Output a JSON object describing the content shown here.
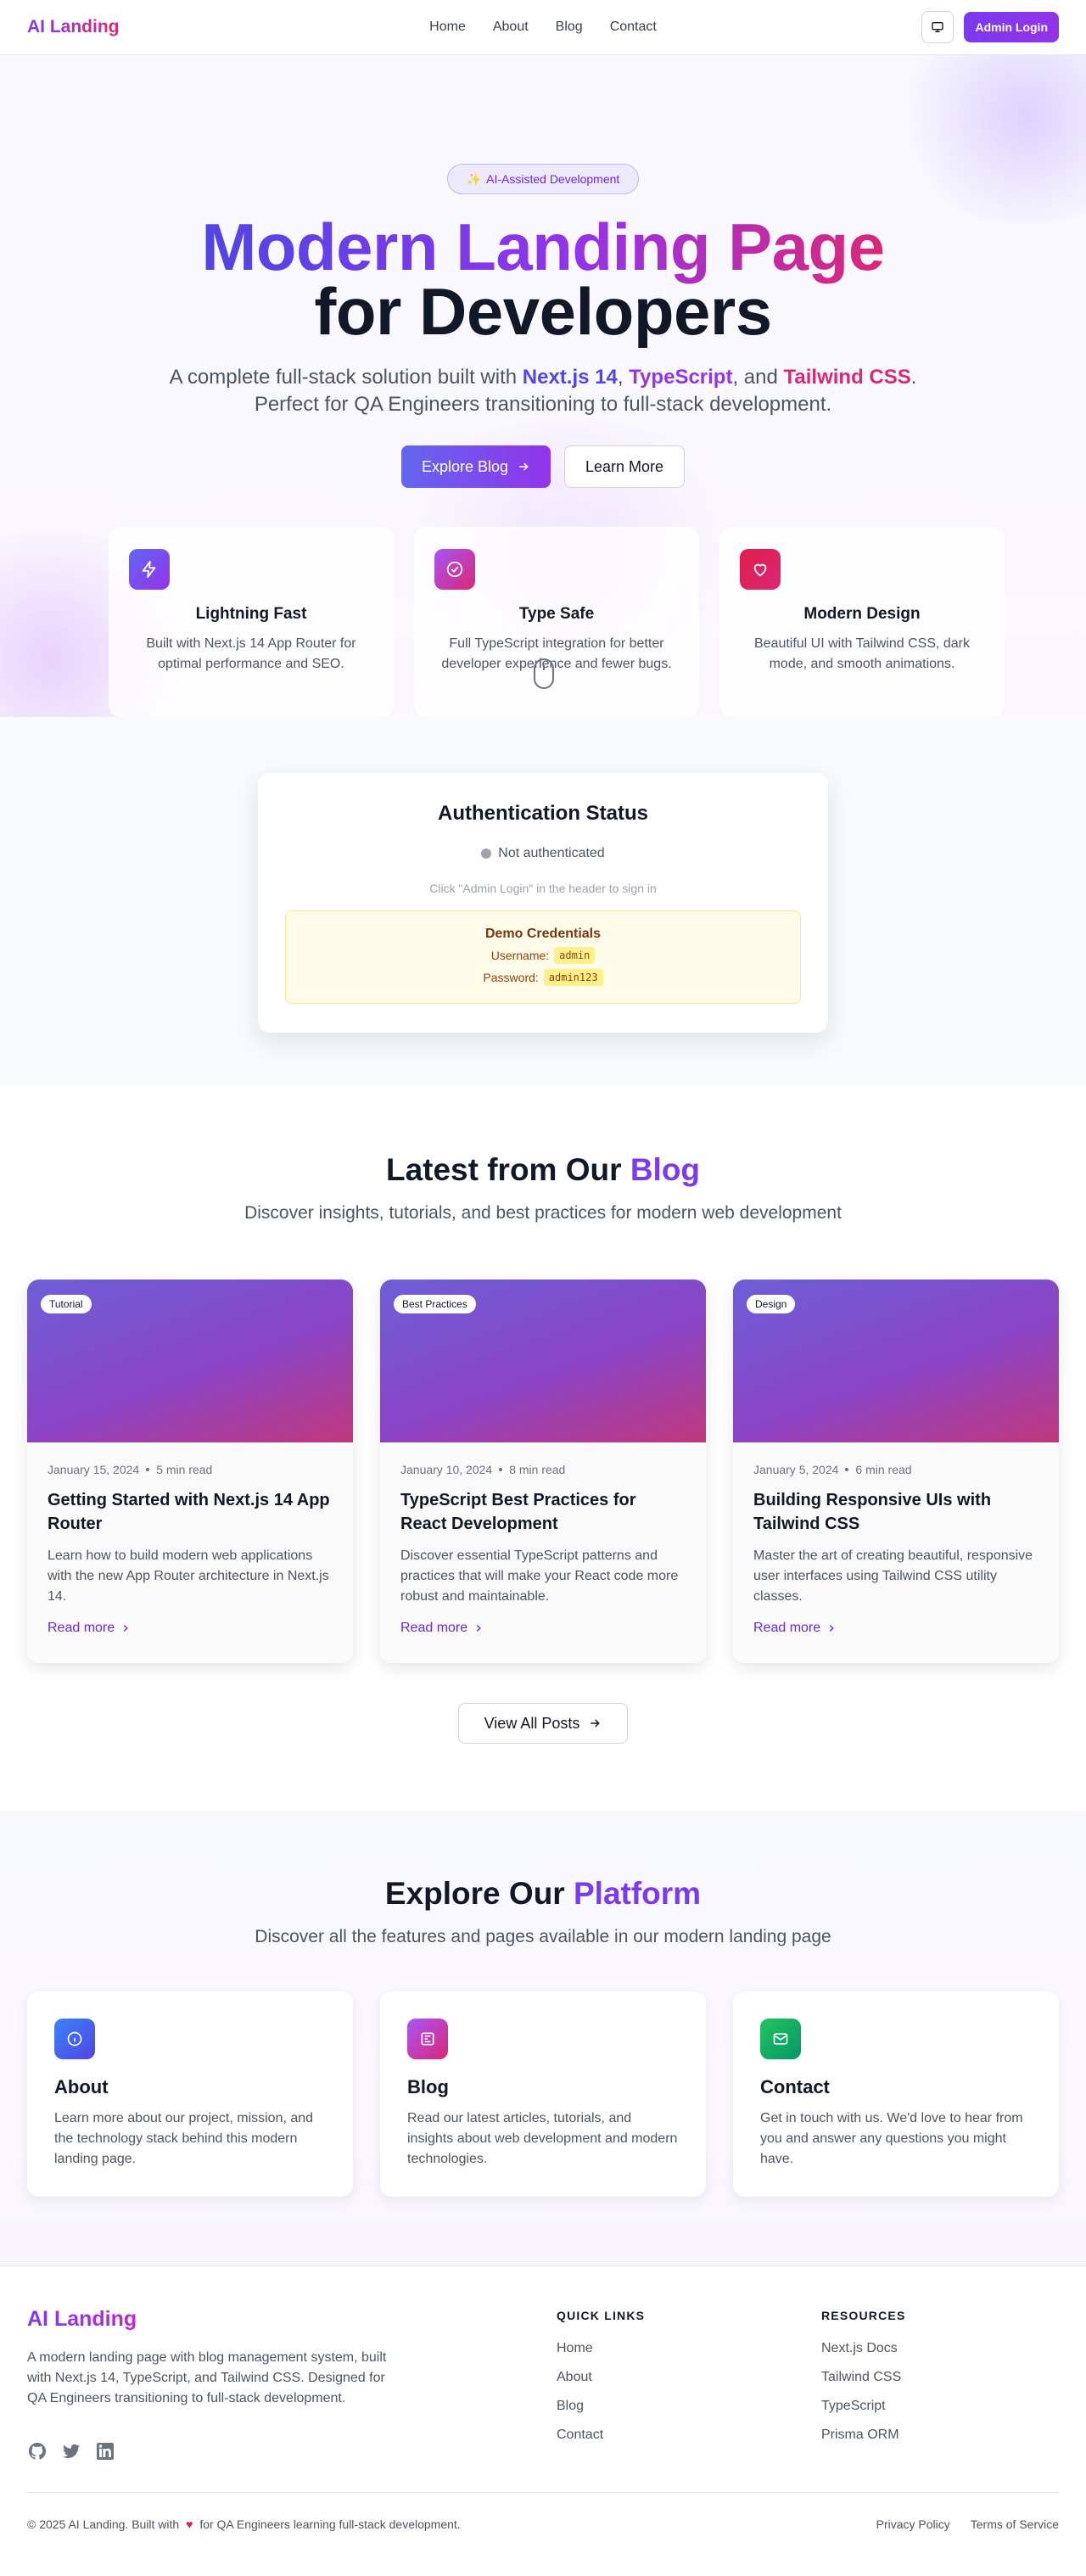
{
  "header": {
    "logo": "AI Landing",
    "nav": [
      "Home",
      "About",
      "Blog",
      "Contact"
    ],
    "admin_button": "Admin Login",
    "theme_icon": "monitor-icon"
  },
  "hero": {
    "badge": "AI-Assisted Development",
    "title_line1": "Modern Landing Page",
    "title_line2": "for Developers",
    "subtitle_prefix": "A complete full-stack solution built with",
    "hl1": "Next.js 14",
    "comma": ",",
    "hl2": "TypeScript",
    "and": ", and",
    "hl3": "Tailwind CSS",
    "subtitle_suffix": ". Perfect for QA Engineers transitioning to full-stack development.",
    "primary_button": "Explore Blog",
    "secondary_button": "Learn More",
    "features": [
      {
        "title": "Lightning Fast",
        "desc": "Built with Next.js 14 App Router for optimal performance and SEO.",
        "icon": "lightning-icon",
        "color": "#7c3aed"
      },
      {
        "title": "Type Safe",
        "desc": "Full TypeScript integration for better developer experience and fewer bugs.",
        "icon": "check-circle-icon",
        "color": "#c026d3"
      },
      {
        "title": "Modern Design",
        "desc": "Beautiful UI with Tailwind CSS, dark mode, and smooth animations.",
        "icon": "heart-icon",
        "color": "#e11d48"
      }
    ]
  },
  "auth": {
    "title": "Authentication Status",
    "status": "Not authenticated",
    "hint": "Click \"Admin Login\" in the header to sign in",
    "demo_title": "Demo Credentials",
    "username_label": "Username:",
    "username": "admin",
    "password_label": "Password:",
    "password": "admin123"
  },
  "blog": {
    "title_prefix": "Latest from Our",
    "title_accent": "Blog",
    "subtitle": "Discover insights, tutorials, and best practices for modern web development",
    "posts": [
      {
        "tag": "Tutorial",
        "date": "January 15, 2024",
        "read": "5 min read",
        "title": "Getting Started with Next.js 14 App Router",
        "desc": "Learn how to build modern web applications with the new App Router architecture in Next.js 14.",
        "link": "Read more"
      },
      {
        "tag": "Best Practices",
        "date": "January 10, 2024",
        "read": "8 min read",
        "title": "TypeScript Best Practices for React Development",
        "desc": "Discover essential TypeScript patterns and practices that will make your React code more robust and maintainable.",
        "link": "Read more"
      },
      {
        "tag": "Design",
        "date": "January 5, 2024",
        "read": "6 min read",
        "title": "Building Responsive UIs with Tailwind CSS",
        "desc": "Master the art of creating beautiful, responsive user interfaces using Tailwind CSS utility classes.",
        "link": "Read more"
      }
    ],
    "view_all": "View All Posts"
  },
  "platform": {
    "title_prefix": "Explore Our",
    "title_accent": "Platform",
    "subtitle": "Discover all the features and pages available in our modern landing page",
    "cards": [
      {
        "title": "About",
        "desc": "Learn more about our project, mission, and the technology stack behind this modern landing page.",
        "icon": "info-icon",
        "color": "#4f46e5"
      },
      {
        "title": "Blog",
        "desc": "Read our latest articles, tutorials, and insights about web development and modern technologies.",
        "icon": "newspaper-icon",
        "color": "#c026d3"
      },
      {
        "title": "Contact",
        "desc": "Get in touch with us. We'd love to hear from you and answer any questions you might have.",
        "icon": "mail-icon",
        "color": "#059669"
      }
    ]
  },
  "footer": {
    "logo": "AI Landing",
    "desc": "A modern landing page with blog management system, built with Next.js 14, TypeScript, and Tailwind CSS. Designed for QA Engineers transitioning to full-stack development.",
    "quick_links_title": "QUICK LINKS",
    "quick_links": [
      "Home",
      "About",
      "Blog",
      "Contact"
    ],
    "resources_title": "RESOURCES",
    "resources": [
      "Next.js Docs",
      "Tailwind CSS",
      "TypeScript",
      "Prisma ORM"
    ],
    "copyright_prefix": "© 2025 AI Landing. Built with",
    "copyright_suffix": "for QA Engineers learning full-stack development.",
    "privacy": "Privacy Policy",
    "terms": "Terms of Service"
  }
}
